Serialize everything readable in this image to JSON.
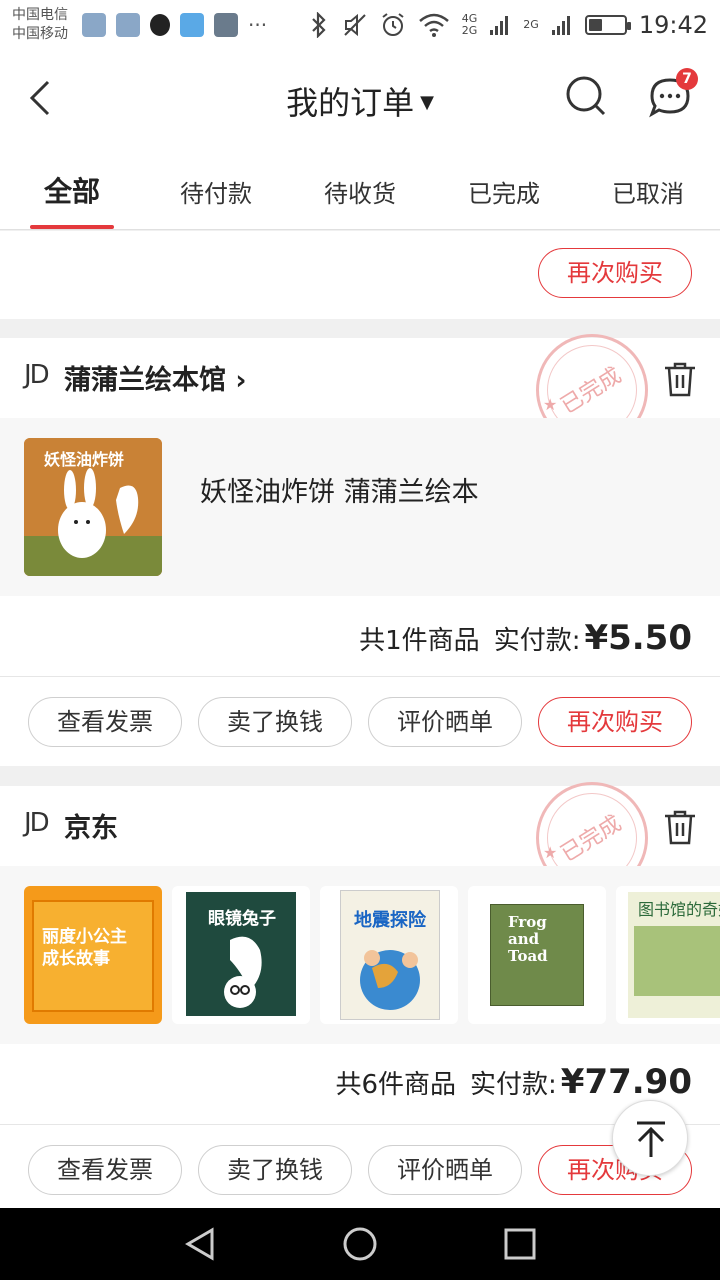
{
  "status_bar": {
    "carrier_1": "中国电信",
    "carrier_2": "中国移动",
    "more": "···",
    "network_1": "4G",
    "network_2": "2G",
    "network_3": "2G",
    "time": "19:42",
    "battery_percent": 40
  },
  "header": {
    "title": "我的订单",
    "message_badge": "7"
  },
  "tabs": [
    {
      "label": "全部",
      "active": true
    },
    {
      "label": "待付款",
      "active": false
    },
    {
      "label": "待收货",
      "active": false
    },
    {
      "label": "已完成",
      "active": false
    },
    {
      "label": "已取消",
      "active": false
    }
  ],
  "top_partial": {
    "rebuy": "再次购买"
  },
  "orders": [
    {
      "logo": "JD",
      "shop": "蒲蒲兰绘本馆",
      "shop_arrow": "›",
      "status_stamp": "已完成",
      "item_title": "妖怪油炸饼 蒲蒲兰绘本",
      "cover_text": "妖怪油炸饼",
      "count_text": "共1件商品",
      "paid_label": "实付款:",
      "price": "¥5.50",
      "buttons": [
        "查看发票",
        "卖了换钱",
        "评价晒单",
        "再次购买"
      ]
    },
    {
      "logo": "JD",
      "shop": "京东",
      "status_stamp": "已完成",
      "covers": [
        "丽度小公主成长故事",
        "眼镜兔子",
        "地震探险",
        "Frog and Toad",
        "图书馆的奇妙夜"
      ],
      "count_text": "共6件商品",
      "paid_label": "实付款:",
      "price": "¥77.90",
      "buttons": [
        "查看发票",
        "卖了换钱",
        "评价晒单",
        "再次购买"
      ]
    }
  ],
  "colors": {
    "accent": "#e4393c",
    "stamp": "#eeaaaa"
  }
}
